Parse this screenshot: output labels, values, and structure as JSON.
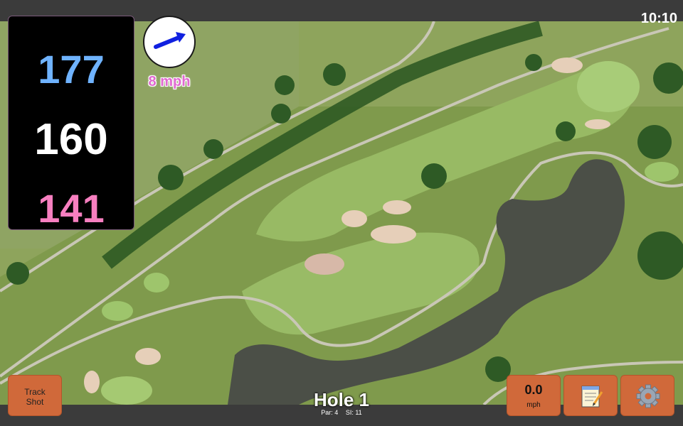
{
  "status": {
    "time": "10:10"
  },
  "distances": {
    "back": "177",
    "middle": "160",
    "front": "141"
  },
  "wind": {
    "speed": "8 mph",
    "direction_icon": "arrow-east-icon"
  },
  "hole": {
    "title": "Hole 1",
    "par": "Par: 4",
    "si": "SI: 11"
  },
  "buttons": {
    "track_shot": "Track\nShot",
    "speed_value": "0.0",
    "speed_unit": "mph",
    "notes_icon": "notepad-icon",
    "settings_icon": "gear-icon"
  },
  "colors": {
    "back_distance": "#6fb3ff",
    "middle_distance": "#ffffff",
    "front_distance": "#f77fc0",
    "button": "#d0693a",
    "wind_text": "#e069d0"
  }
}
